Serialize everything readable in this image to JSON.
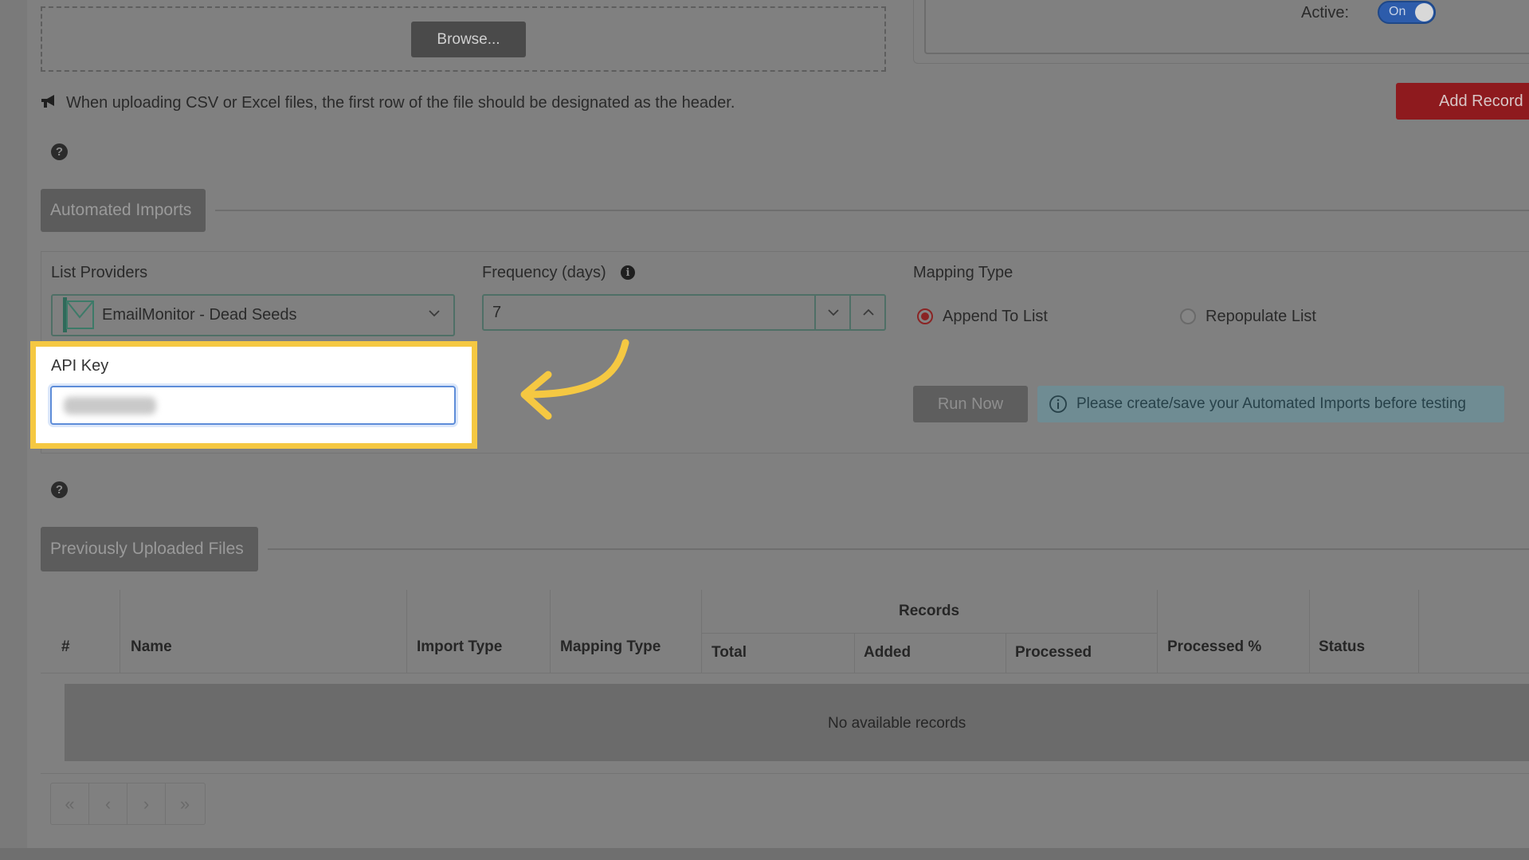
{
  "upload": {
    "browse_label": "Browse..."
  },
  "active": {
    "label": "Active:",
    "toggle_text": "On"
  },
  "add_record_label": "Add Record",
  "notice_header": "When uploading CSV or Excel files, the first row of the file should be designated as the header.",
  "help_glyph": "?",
  "sections": {
    "automated_imports": "Automated Imports",
    "previous_uploads": "Previously Uploaded Files"
  },
  "form": {
    "list_providers_label": "List Providers",
    "list_provider_value": "EmailMonitor - Dead Seeds",
    "frequency_label": "Frequency (days)",
    "frequency_value": "7",
    "info_glyph": "i",
    "mapping_type_label": "Mapping Type",
    "mapping_options": [
      {
        "label": "Append To List",
        "selected": true
      },
      {
        "label": "Repopulate List",
        "selected": false
      }
    ],
    "api_key_label": "API Key",
    "api_key_value_blurred": true
  },
  "run_now_label": "Run Now",
  "run_notice": "Please create/save your Automated Imports before testing",
  "table": {
    "columns": {
      "num": "#",
      "name": "Name",
      "import_type": "Import Type",
      "mapping_type": "Mapping Type",
      "records": "Records",
      "total": "Total",
      "added": "Added",
      "processed": "Processed",
      "processed_pct": "Processed %",
      "status": "Status"
    },
    "empty_text": "No available records"
  },
  "pager": [
    "«",
    "‹",
    "›",
    "»"
  ],
  "colors": {
    "highlight": "#f5c842",
    "add_record": "#8e1a1e",
    "toggle": "#2d5cab",
    "radio_selected": "#8a2424"
  }
}
